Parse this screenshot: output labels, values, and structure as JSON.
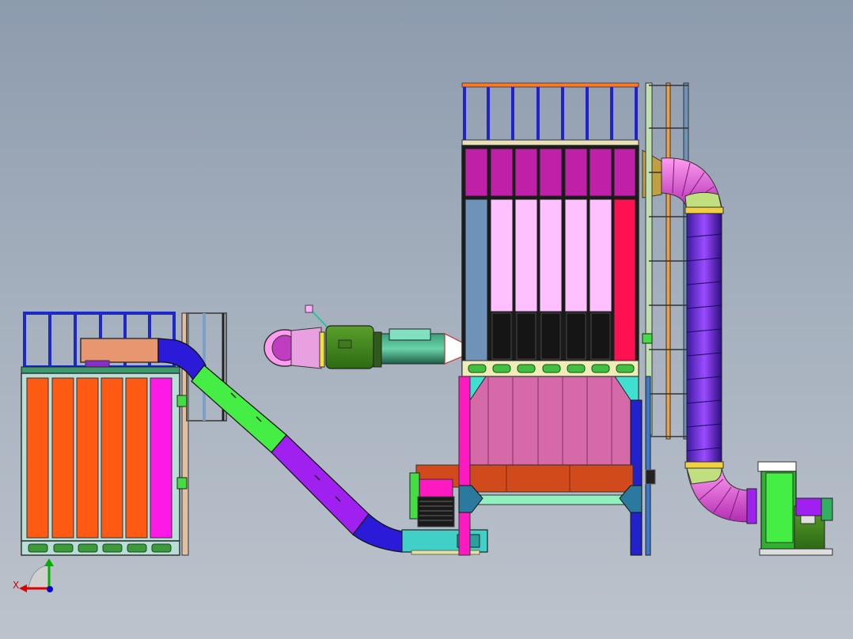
{
  "viewport": {
    "background_top": "#8d9bae",
    "background_bottom": "#bcc3cc"
  },
  "triad": {
    "x_label": "X",
    "x_color": "#e00000",
    "y_color": "#00b000",
    "z_color": "#0000d0"
  },
  "model": {
    "components": [
      "left-filter-unit",
      "inclined-screw-conveyor",
      "inlet-duct-fan",
      "baghouse-dust-collector",
      "ladder-and-railing",
      "outlet-duct-elbow",
      "centrifugal-fan",
      "rotary-valve-discharge"
    ],
    "colors": {
      "orange": "#ff5a14",
      "magenta": "#ff19e6",
      "pink": "#ffc0ff",
      "violet": "#a020f0",
      "green": "#44ee44",
      "navy": "#2222cc",
      "red": "#ff1050",
      "steel": "#6f93b8"
    }
  }
}
